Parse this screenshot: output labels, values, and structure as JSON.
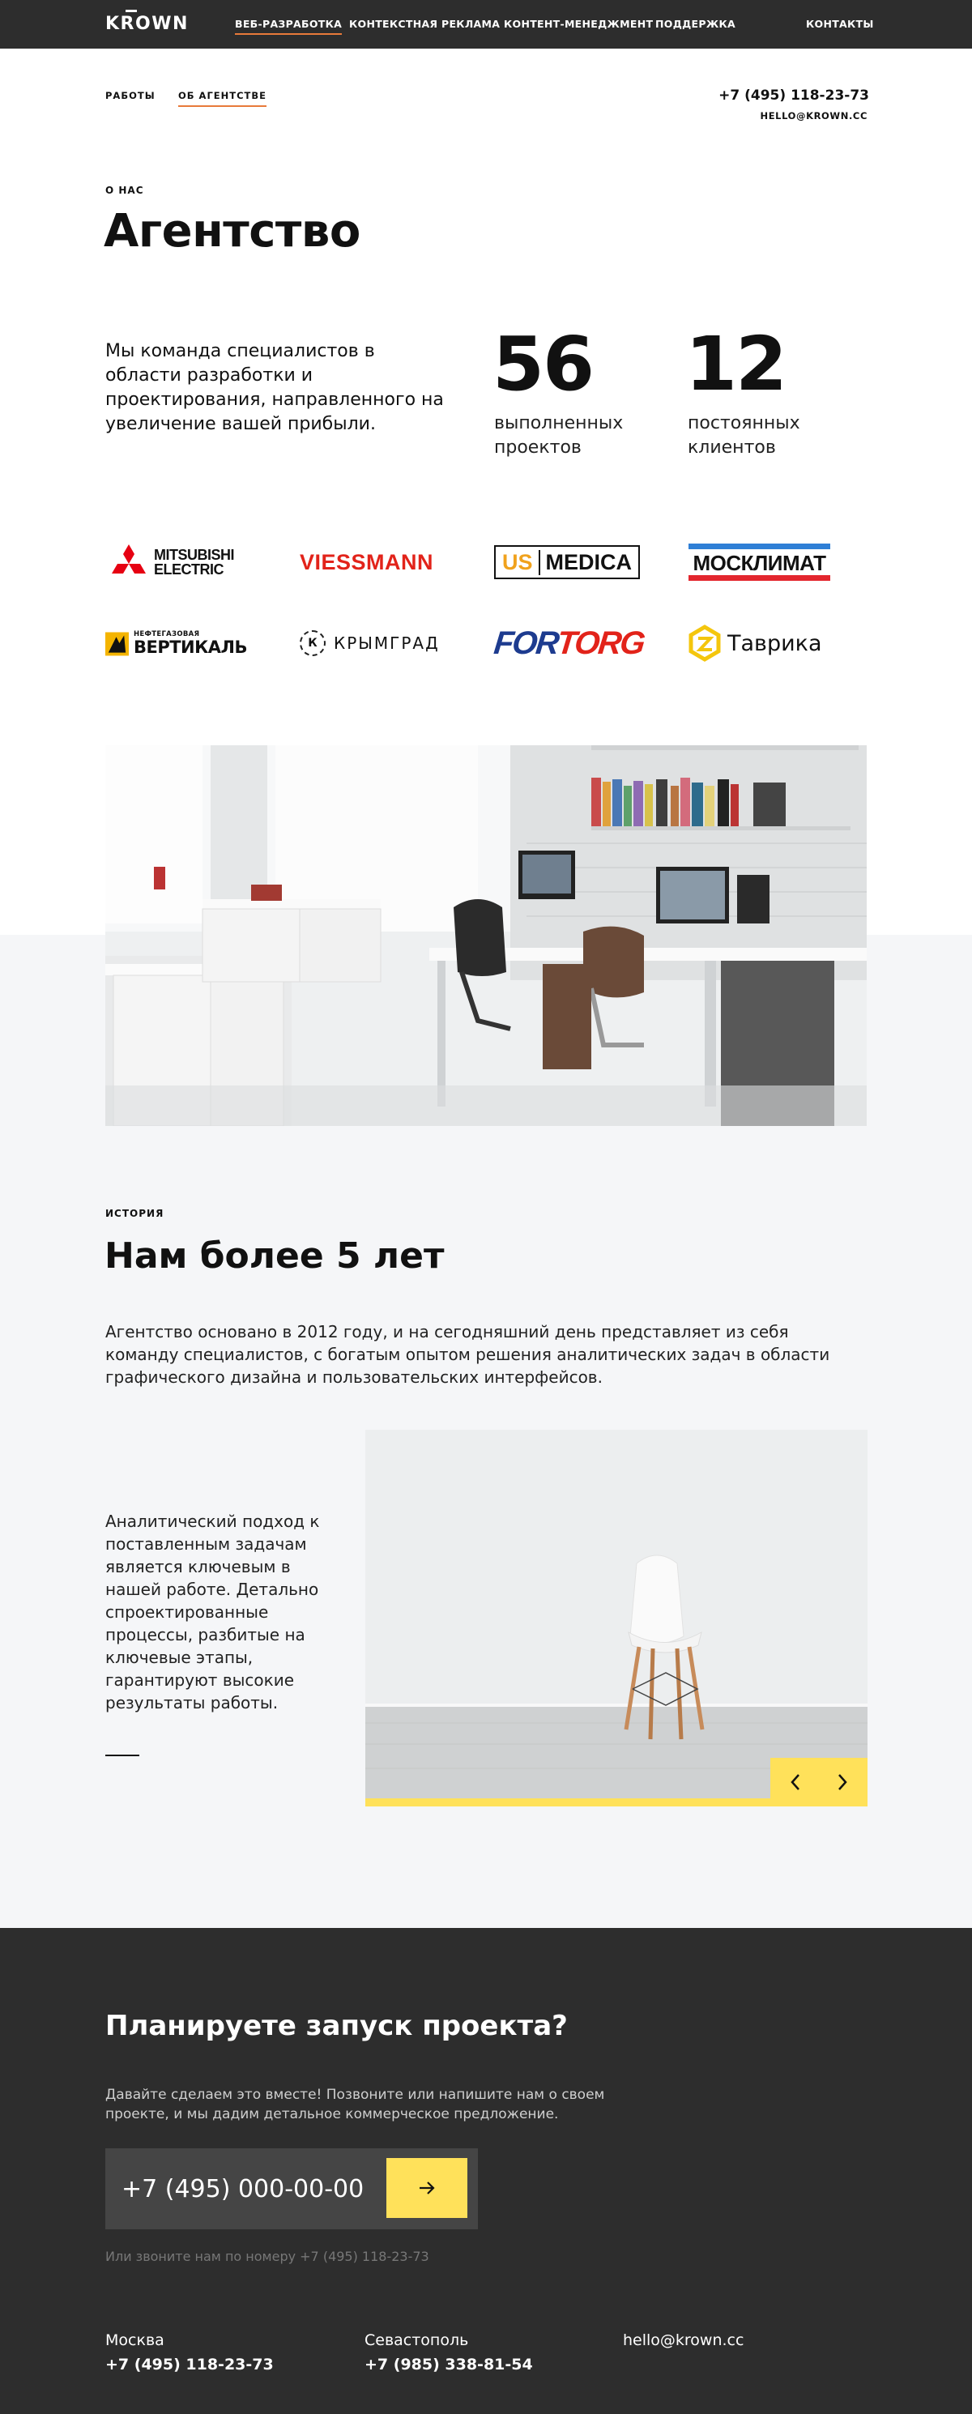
{
  "brand": {
    "logo": "KROWN"
  },
  "nav": {
    "items": [
      {
        "label": "ВЕБ-РАЗРАБОТКА"
      },
      {
        "label": "КОНТЕКСТНАЯ РЕКЛАМА"
      },
      {
        "label": "КОНТЕНТ-МЕНЕДЖМЕНТ"
      },
      {
        "label": "ПОДДЕРЖКА"
      }
    ],
    "contacts": "КОНТАКТЫ",
    "active_color": "#e87a3a"
  },
  "subnav": {
    "items": [
      {
        "label": "РАБОТЫ"
      },
      {
        "label": "ОБ АГЕНТСТВЕ"
      }
    ],
    "phone": "+7 (495) 118-23-73",
    "email": "HELLO@KROWN.CC"
  },
  "about": {
    "eyebrow": "О НАС",
    "title": "Агентство",
    "lead": "Мы команда специалистов в области разработки и проектирования, направленного на увеличение вашей прибыли.",
    "stats": [
      {
        "value": "56",
        "label": "выполненных проектов"
      },
      {
        "value": "12",
        "label": "постоянных клиентов"
      }
    ]
  },
  "clients": {
    "logos": [
      {
        "name": "MITSUBISHI ELECTRIC",
        "line1": "MITSUBISHI",
        "line2": "ELECTRIC",
        "color": "#e60012"
      },
      {
        "name": "VIESSMANN",
        "text": "VIESSMANN",
        "color": "#e2231a"
      },
      {
        "name": "US MEDICA",
        "part1": "US",
        "part2": "MEDICA",
        "color": "#f0a21d"
      },
      {
        "name": "МОСКЛИМАТ",
        "text": "МОСКЛИМАТ",
        "color_top": "#2f7fd6",
        "color_bottom": "#e3262e"
      },
      {
        "name": "НЕФТЕГАЗОВАЯ ВЕРТИКАЛЬ",
        "line1": "НЕФТЕГАЗОВАЯ",
        "line2": "ВЕРТИКАЛЬ",
        "color": "#f4b400"
      },
      {
        "name": "КРЫМГРАД",
        "text": "КРЫМГРАД",
        "mark": "К"
      },
      {
        "name": "FORTORG",
        "part1": "FOR",
        "part2": "TORG",
        "color1": "#1d3b8f",
        "color2": "#e2231a"
      },
      {
        "name": "Таврика",
        "text": "Таврика",
        "color": "#f4c60d"
      }
    ]
  },
  "history": {
    "eyebrow": "ИСТОРИЯ",
    "title": "Нам более 5 лет",
    "paragraph": "Агентство основано в 2012 году, и на сегодняшний день представляет из себя команду специалистов, с богатым опытом решения аналитических задач в области графического дизайна и пользовательских интерфейсов.",
    "side_text": "Аналитический подход к поставленным задачам является ключевым в нашей работе. Детально спроектированные процессы, разбитые на ключевые этапы, гарантируют высокие результаты работы.",
    "accent_color": "#ffe15a",
    "slider_progress": 0.5
  },
  "cta": {
    "title": "Планируете запуск проекта?",
    "text": "Давайте сделаем это вместе! Позвоните или напишите нам о своем проекте, и мы дадим детальное коммерческое предложение.",
    "phone_placeholder": "+7 (495) 000-00-00",
    "hint": "Или звоните нам по номеру +7 (495) 118-23-73"
  },
  "footer": {
    "offices": [
      {
        "city": "Москва",
        "phone": "+7 (495) 118-23-73"
      },
      {
        "city": "Севастополь",
        "phone": "+7 (985) 338-81-54"
      }
    ],
    "email": "hello@krown.cc"
  },
  "colors": {
    "dark": "#2d2d2d",
    "yellow": "#ffe15a",
    "orange": "#e87a3a",
    "light_bg": "#f5f6f8"
  }
}
